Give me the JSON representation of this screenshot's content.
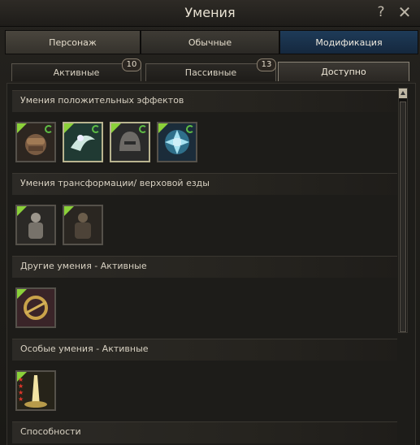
{
  "window": {
    "title": "Умения",
    "help_label": "?",
    "close_label": "✕"
  },
  "main_tabs": [
    {
      "label": "Персонаж"
    },
    {
      "label": "Обычные"
    },
    {
      "label": "Модификация"
    }
  ],
  "sub_tabs": [
    {
      "label": "Активные",
      "badge": "10"
    },
    {
      "label": "Пассивные",
      "badge": "13"
    },
    {
      "label": "Доступно"
    }
  ],
  "sections": [
    {
      "title": "Умения положительных эффектов",
      "icons": [
        "fist-skill-icon",
        "wind-skill-icon",
        "helmet-skill-icon",
        "shield-skill-icon"
      ]
    },
    {
      "title": "Умения трансформации/ верховой езды",
      "icons": [
        "knight-transform-icon",
        "warrior-transform-icon"
      ]
    },
    {
      "title": "Другие умения - Активные",
      "icons": [
        "gear-skill-icon"
      ]
    },
    {
      "title": "Особые умения - Активные",
      "icons": [
        "light-beam-skill-icon"
      ]
    },
    {
      "title": "Способности"
    }
  ],
  "colors": {
    "active_tab": "#1e3b58",
    "green_marker": "#8bd13a",
    "selected_border": "#b9b48f"
  }
}
